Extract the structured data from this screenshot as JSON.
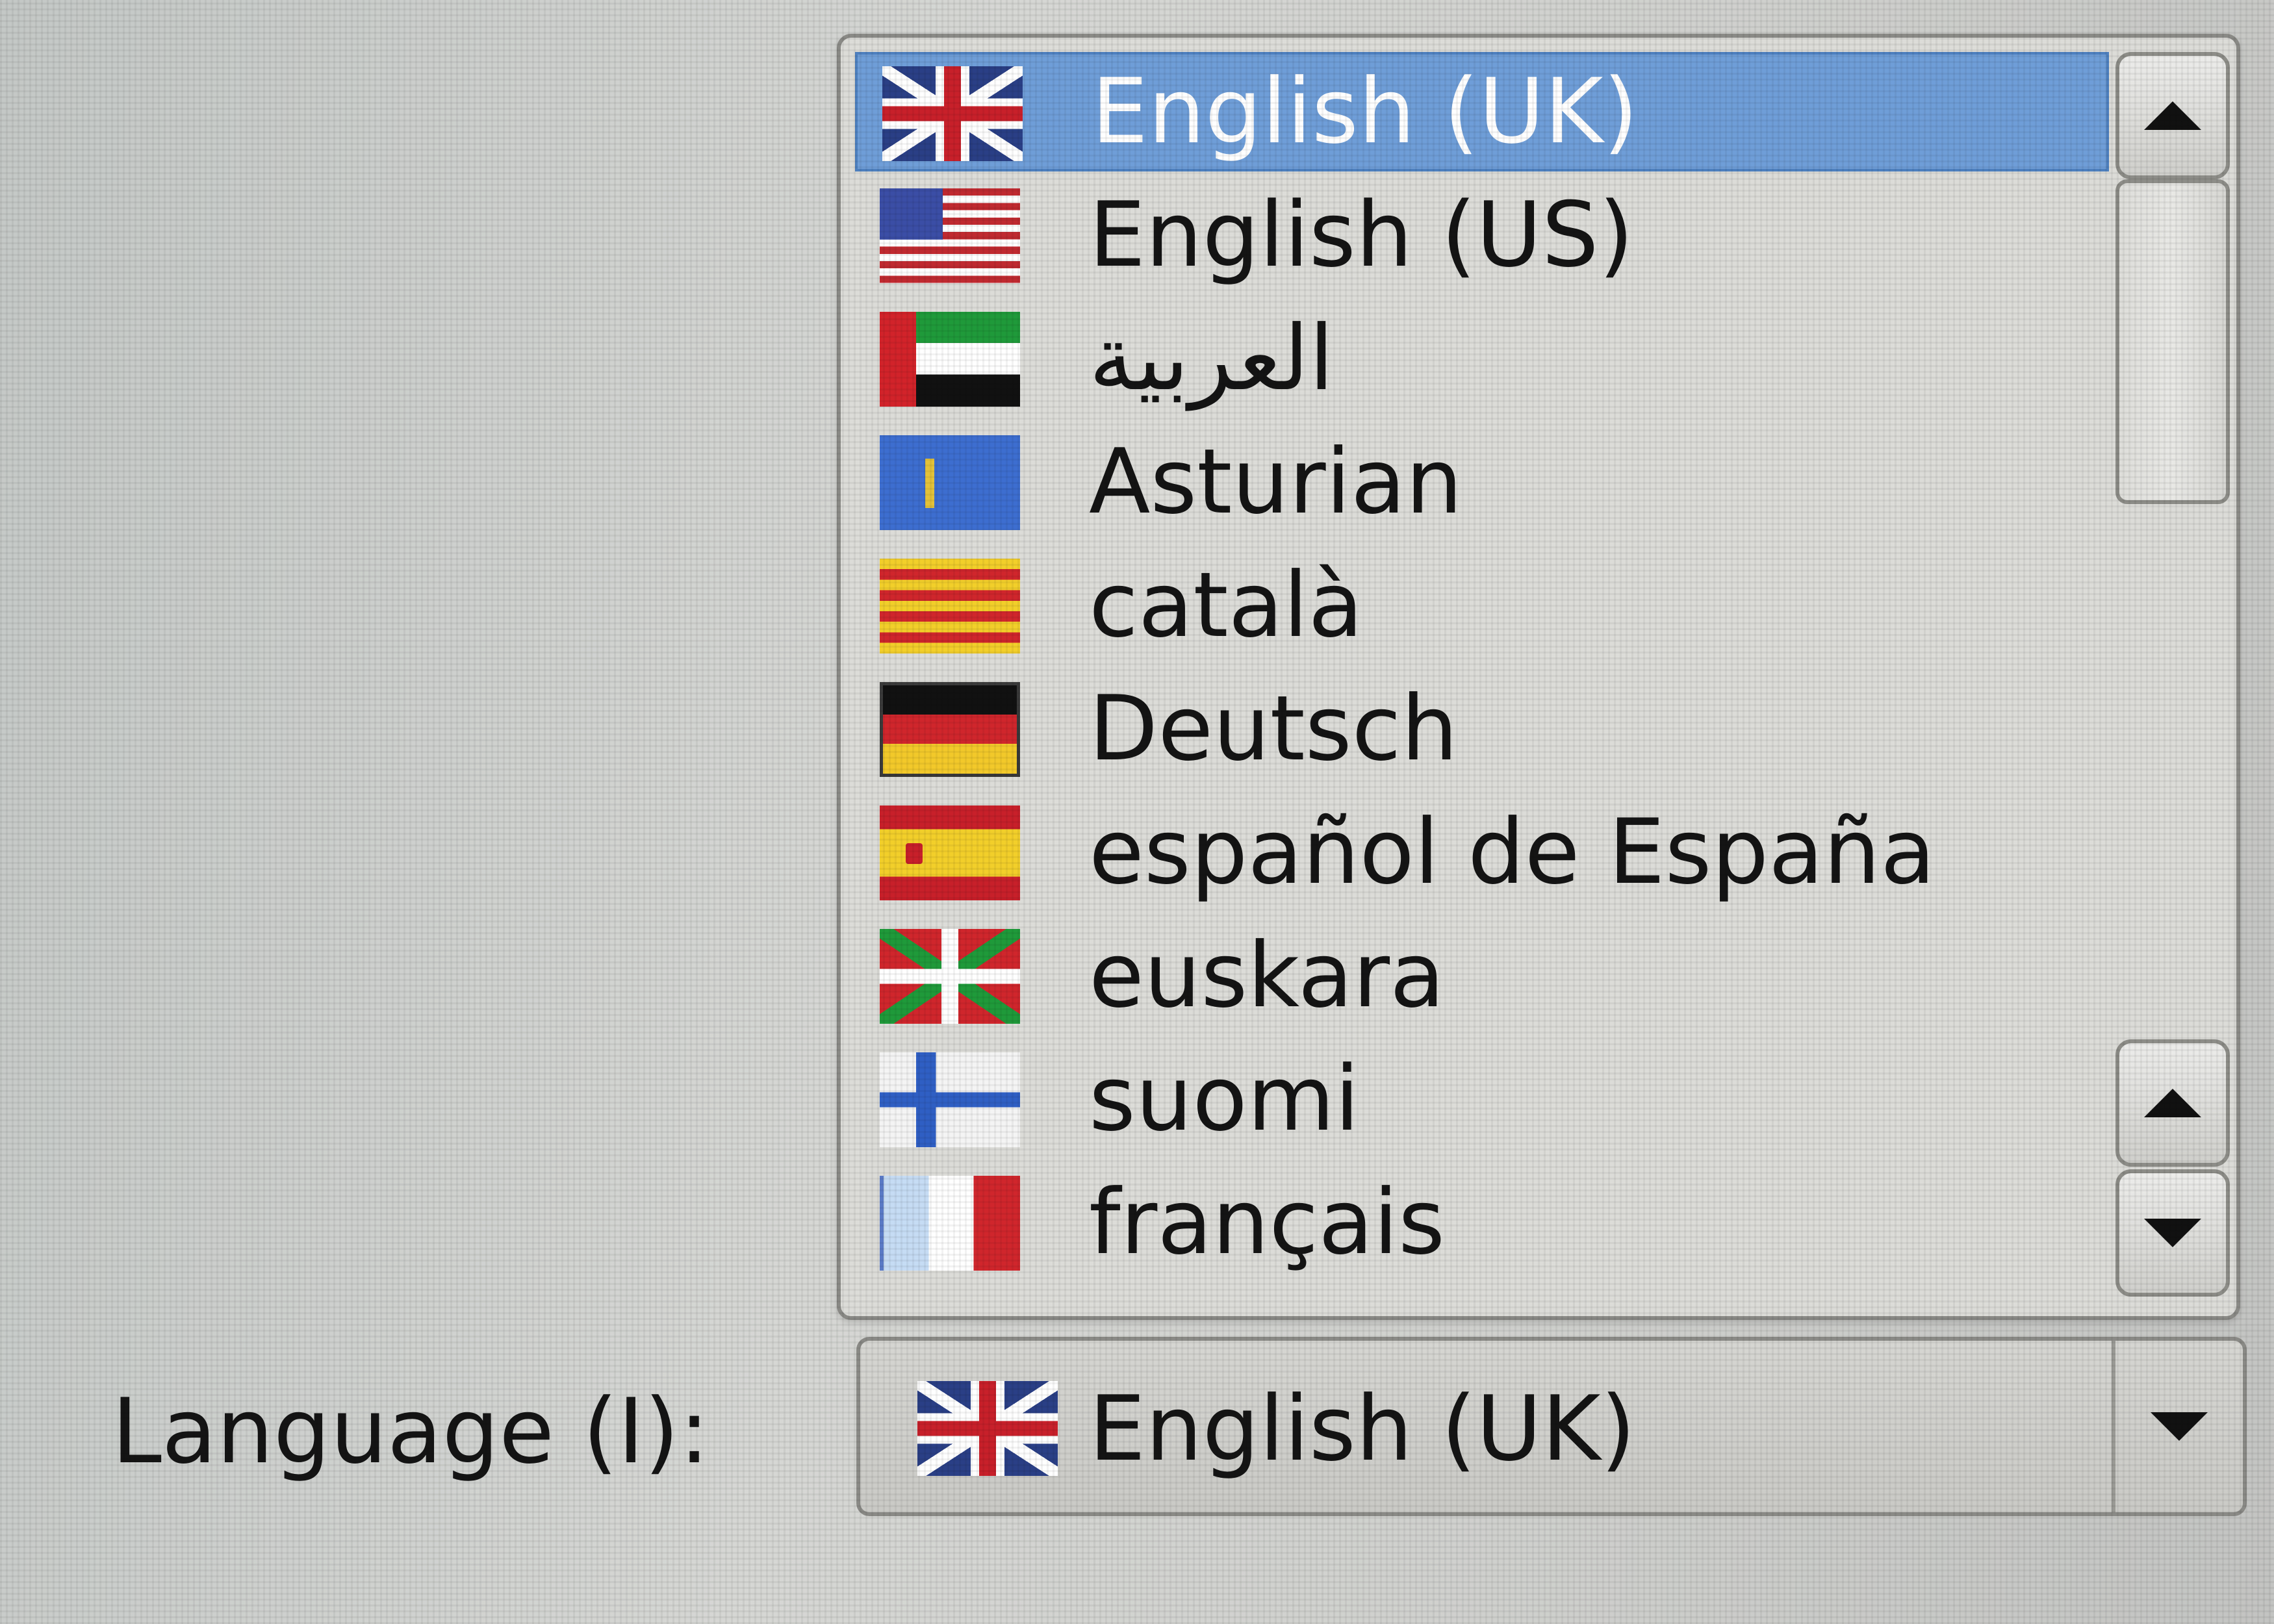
{
  "language_selector": {
    "label": "Language (I):",
    "selected": {
      "text": "English (UK)",
      "flag": "united-kingdom-flag"
    },
    "options": [
      {
        "text": "English (UK)",
        "flag": "united-kingdom-flag",
        "selected": true
      },
      {
        "text": "English (US)",
        "flag": "united-states-flag"
      },
      {
        "text": "العربية",
        "flag": "uae-flag"
      },
      {
        "text": "Asturian",
        "flag": "asturias-flag"
      },
      {
        "text": "català",
        "flag": "catalonia-flag"
      },
      {
        "text": "Deutsch",
        "flag": "germany-flag"
      },
      {
        "text": "español de España",
        "flag": "spain-flag"
      },
      {
        "text": "euskara",
        "flag": "basque-flag"
      },
      {
        "text": "suomi",
        "flag": "finland-flag"
      },
      {
        "text": "français",
        "flag": "france-flag"
      }
    ]
  },
  "colors": {
    "selection": "#6f9ed8",
    "background": "#d6d7d4"
  }
}
